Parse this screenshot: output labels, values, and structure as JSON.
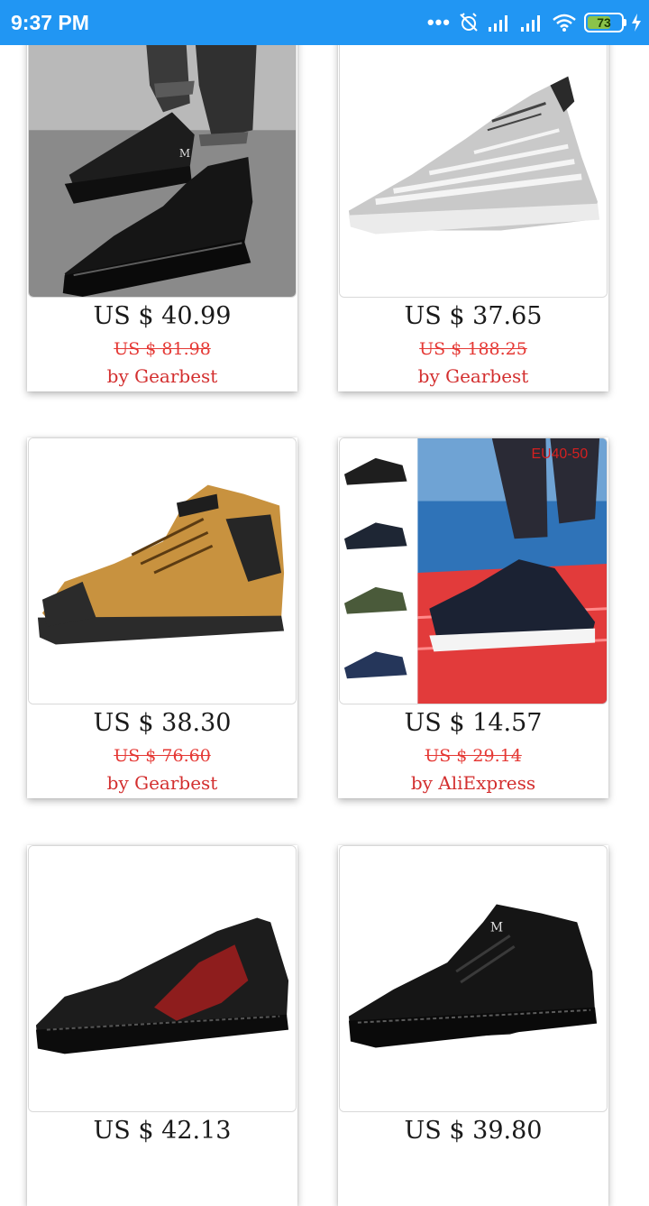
{
  "status_bar": {
    "time": "9:37 PM",
    "battery_level": "73",
    "battery_fraction": 0.73,
    "battery_color": "#8bc34a",
    "icons": [
      "more-dots-icon",
      "alarm-off-icon",
      "signal-icon",
      "signal-icon",
      "wifi-icon",
      "battery-icon",
      "charging-icon"
    ]
  },
  "products": [
    {
      "price": "US $ 40.99",
      "old_price": "US $ 81.98",
      "seller": "by Gearbest",
      "image": "black-high-top-boots-on-feet-image"
    },
    {
      "price": "US $ 37.65",
      "old_price": "US $ 188.25",
      "seller": "by Gearbest",
      "image": "grey-knit-sneaker-image"
    },
    {
      "price": "US $ 38.30",
      "old_price": "US $ 76.60",
      "seller": "by Gearbest",
      "image": "tan-hiking-boot-image"
    },
    {
      "price": "US $ 14.57",
      "old_price": "US $ 29.14",
      "seller": "by AliExpress",
      "image": "mesh-sneaker-color-variants-image",
      "badge": "EU40-50"
    },
    {
      "price": "US $ 42.13",
      "old_price": "",
      "seller": "",
      "image": "black-red-loafer-image"
    },
    {
      "price": "US $ 39.80",
      "old_price": "",
      "seller": "",
      "image": "black-suede-sneaker-image"
    }
  ],
  "colors": {
    "status_bar": "#2196f3",
    "price": "#1a1a1a",
    "old_price": "#e53935",
    "seller": "#d32f2f"
  }
}
